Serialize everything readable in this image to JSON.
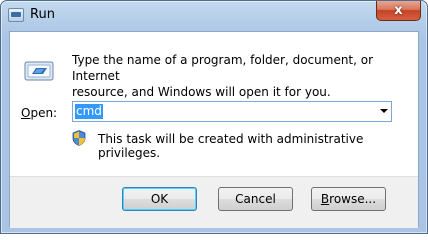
{
  "window": {
    "title": "Run",
    "close_glyph": "x"
  },
  "description": {
    "line1": "Type the name of a program, folder, document, or Internet",
    "line2": "resource, and Windows will open it for you."
  },
  "open": {
    "label_underlined": "O",
    "label_rest": "pen:",
    "value": "cmd"
  },
  "admin_notice": "This task will be created with administrative privileges.",
  "buttons": {
    "ok": "OK",
    "cancel": "Cancel",
    "browse_underlined": "B",
    "browse_rest": "rowse..."
  },
  "icons": [
    "run-icon",
    "shield-icon",
    "dropdown-arrow-icon",
    "close-icon"
  ],
  "colors": {
    "selection": "#3399ff",
    "close_button": "#c64326",
    "title_bar": "#b9d1ea"
  }
}
